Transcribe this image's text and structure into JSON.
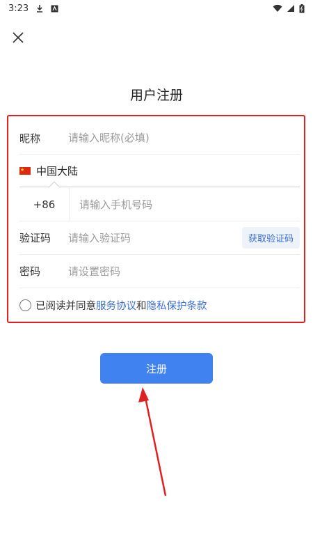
{
  "status_bar": {
    "time": "3:23"
  },
  "page": {
    "title": "用户注册"
  },
  "form": {
    "nickname": {
      "label": "昵称",
      "placeholder": "请输入昵称(必填)"
    },
    "region": {
      "label": "中国大陆"
    },
    "phone": {
      "code": "+86",
      "placeholder": "请输入手机号码"
    },
    "verify": {
      "label": "验证码",
      "placeholder": "请输入验证码",
      "button": "获取验证码"
    },
    "password": {
      "label": "密码",
      "placeholder": "请设置密码"
    },
    "agreement": {
      "prefix": "已阅读并同意",
      "service_link": "服务协议",
      "and": "和",
      "privacy_link": "隐私保护条款"
    }
  },
  "register_button": "注册",
  "colors": {
    "accent": "#3f82f0",
    "highlight_border": "#e02020",
    "link": "#3a6fd8"
  },
  "icons": [
    "download-icon",
    "app-icon",
    "wifi-icon",
    "signal-icon",
    "battery-icon",
    "close-icon",
    "flag-icon",
    "arrow-annotation"
  ]
}
